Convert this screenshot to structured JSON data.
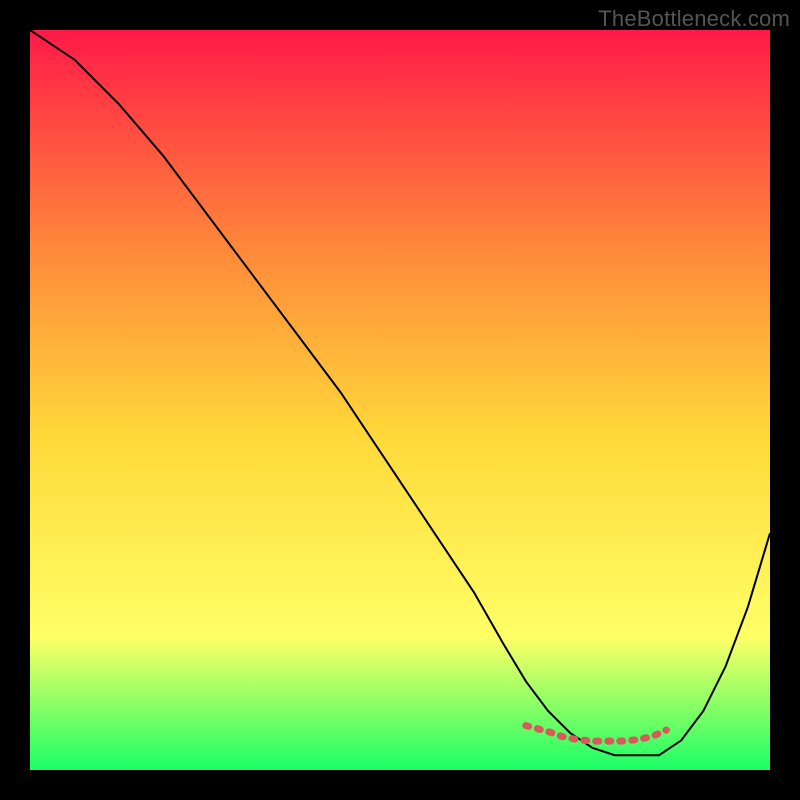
{
  "watermark": "TheBottleneck.com",
  "chart_data": {
    "type": "line",
    "title": "",
    "xlabel": "",
    "ylabel": "",
    "xlim": [
      0,
      100
    ],
    "ylim": [
      0,
      100
    ],
    "background_gradient": {
      "top": "#ff1a48",
      "upper_mid": "#ff8a3a",
      "mid": "#ffd93a",
      "lower_mid": "#ffff66",
      "bottom": "#1aff66"
    },
    "series": [
      {
        "name": "bottleneck-curve",
        "color": "#000000",
        "stroke_width": 2,
        "x": [
          0,
          6,
          12,
          18,
          24,
          30,
          36,
          42,
          48,
          54,
          60,
          64,
          67,
          70,
          73,
          76,
          79,
          82,
          85,
          88,
          91,
          94,
          97,
          100
        ],
        "values": [
          100,
          96,
          90,
          83,
          75,
          67,
          59,
          51,
          42,
          33,
          24,
          17,
          12,
          8,
          5,
          3,
          2,
          2,
          2,
          4,
          8,
          14,
          22,
          32
        ]
      },
      {
        "name": "optimal-range-marker",
        "color": "#d85a5a",
        "stroke_width": 7,
        "x": [
          67,
          70,
          72,
          73,
          74,
          76,
          78,
          80,
          82,
          84,
          86
        ],
        "values": [
          6,
          5.2,
          4.5,
          4.3,
          4.1,
          3.9,
          3.9,
          3.9,
          4.1,
          4.5,
          5.4
        ]
      }
    ]
  }
}
